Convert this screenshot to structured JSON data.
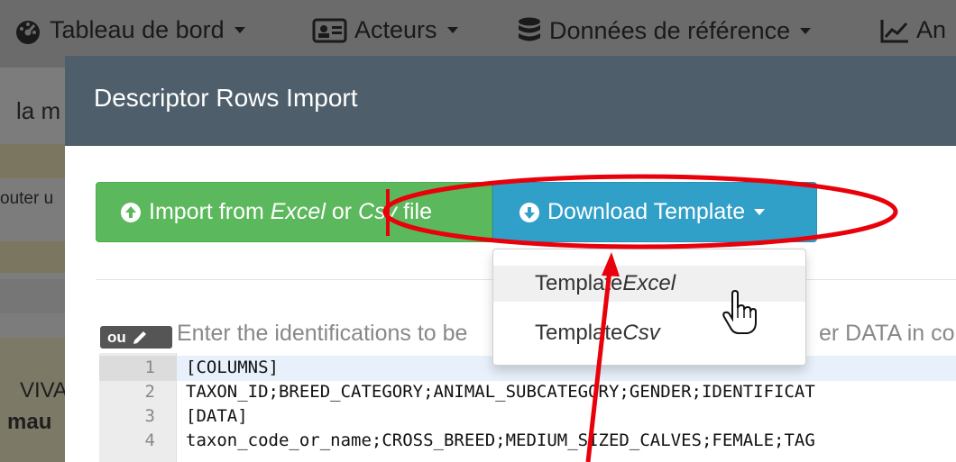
{
  "navbar": {
    "items": [
      {
        "label": "Tableau de bord",
        "icon": "dashboard-icon"
      },
      {
        "label": "Acteurs",
        "icon": "id-card-icon"
      },
      {
        "label": "Données de référence",
        "icon": "database-icon"
      },
      {
        "label": "An",
        "icon": "line-chart-icon"
      }
    ]
  },
  "background": {
    "text_1": "la m",
    "text_2": "outer u",
    "text_3": "VIVA",
    "text_4": "mau"
  },
  "modal": {
    "title": "Descriptor Rows Import",
    "import_button": {
      "prefix": "Import from ",
      "excel": "Excel",
      "mid": " or ",
      "csv": "Csv",
      "suffix": " file"
    },
    "download_button": {
      "label": "Download Template"
    },
    "dropdown": {
      "items": [
        {
          "prefix": "Template ",
          "format": "Excel"
        },
        {
          "prefix": "Template ",
          "format": "Csv"
        }
      ]
    },
    "badge": "ou",
    "help_text": "Enter the identifications to be",
    "help_text_tail": "er DATA in co"
  },
  "editor": {
    "lines": [
      {
        "num": "1",
        "text": "[COLUMNS]"
      },
      {
        "num": "2",
        "text": "TAXON_ID;BREED_CATEGORY;ANIMAL_SUBCATEGORY;GENDER;IDENTIFICAT"
      },
      {
        "num": "3",
        "text": "[DATA]"
      },
      {
        "num": "4",
        "text": "taxon_code_or_name;CROSS_BREED;MEDIUM_SIZED_CALVES;FEMALE;TAG"
      }
    ]
  },
  "colors": {
    "modal_header": "#4e5f6b",
    "import_button": "#5cb85c",
    "download_button": "#31a0c9",
    "annotation": "#e8000b"
  }
}
